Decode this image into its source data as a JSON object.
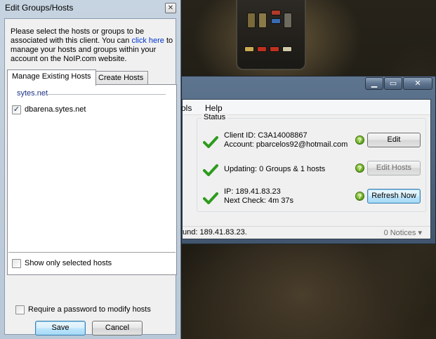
{
  "dialog": {
    "title": "Edit Groups/Hosts",
    "close_glyph": "✕",
    "intro_before_link": "Please select the hosts or groups to be associated with this client. You can ",
    "intro_link": "click here",
    "intro_after_link": " to manage your hosts and groups within your account on the NoIP.com website.",
    "tabs": [
      "Manage Existing Hosts",
      "Create Hosts"
    ],
    "group_name": "sytes.net",
    "hosts": [
      {
        "name": "dbarena.sytes.net",
        "checked": true
      }
    ],
    "show_only_selected_label": "Show only selected hosts",
    "require_password_label": "Require a password to modify hosts",
    "save_label": "Save",
    "cancel_label": "Cancel"
  },
  "main_window": {
    "controls": [
      "▁",
      "▭",
      "✕"
    ],
    "menu": [
      "ols",
      "Help"
    ],
    "status_label": "Status",
    "rows": [
      {
        "line1": "Client ID: C3A14008867",
        "line2": "Account: pbarcelos92@hotmail.com",
        "button": "Edit"
      },
      {
        "line1": "Updating: 0 Groups & 1 hosts",
        "line2": "",
        "button": "Edit Hosts"
      },
      {
        "line1": "IP: 189.41.83.23",
        "line2": "Next Check: 4m 37s",
        "button": "Refresh Now"
      }
    ],
    "help_glyph": "?",
    "status_bar_ip": "und: 189.41.83.23.",
    "notices": "0 Notices ▾"
  },
  "colors": {
    "check_green": "#2e9b1e",
    "link_blue": "#0033cc",
    "group_header": "#1e3287"
  }
}
